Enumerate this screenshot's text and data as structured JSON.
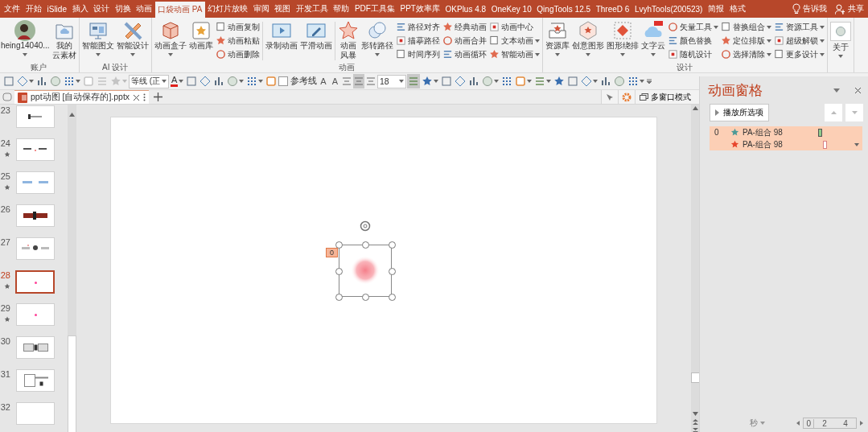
{
  "menu_tabs": [
    {
      "label": "文件",
      "selected": false
    },
    {
      "label": "开始",
      "selected": false
    },
    {
      "label": "iSlide",
      "selected": false
    },
    {
      "label": "插入",
      "selected": false
    },
    {
      "label": "设计",
      "selected": false
    },
    {
      "label": "切换",
      "selected": false
    },
    {
      "label": "动画",
      "selected": false
    },
    {
      "label": "口袋动画 PA",
      "selected": true
    },
    {
      "label": "幻灯片放映",
      "selected": false
    },
    {
      "label": "审阅",
      "selected": false
    },
    {
      "label": "视图",
      "selected": false
    },
    {
      "label": "开发工具",
      "selected": false
    },
    {
      "label": "帮助",
      "selected": false
    },
    {
      "label": "PDF工具集",
      "selected": false
    },
    {
      "label": "PPT效率库",
      "selected": false
    },
    {
      "label": "OKPlus 4.8",
      "selected": false
    },
    {
      "label": "OneKey 10",
      "selected": false
    },
    {
      "label": "QingTools 12.5",
      "selected": false
    },
    {
      "label": "ThreeD 6",
      "selected": false
    },
    {
      "label": "LvyhTools(200523)",
      "selected": false
    },
    {
      "label": "简报",
      "selected": false
    },
    {
      "label": "格式",
      "selected": false
    }
  ],
  "tell_me": "告诉我",
  "share": "共享",
  "ribbon_groups": [
    {
      "label": "账户",
      "columns": [
        {
          "kind": "account",
          "label": "heing14040...",
          "dropdown": true
        },
        {
          "kind": "large",
          "lines": [
            "我的",
            "云素材"
          ],
          "dropdown": false
        }
      ]
    },
    {
      "label": "AI 设计",
      "columns": [
        {
          "kind": "large",
          "label": "智能图文",
          "dropdown": true
        },
        {
          "kind": "large",
          "label": "智能设计",
          "dropdown": true
        }
      ]
    },
    {
      "label": "动画",
      "columns": [
        {
          "kind": "large",
          "label": "动画盒子",
          "dropdown": true
        },
        {
          "kind": "large",
          "label": "动画库",
          "dropdown": false
        },
        {
          "kind": "small",
          "items": [
            {
              "label": "动画复制",
              "dropdown": false
            },
            {
              "label": "动画粘贴",
              "dropdown": false
            },
            {
              "label": "动画删除",
              "dropdown": false
            }
          ]
        },
        {
          "kind": "separator"
        },
        {
          "kind": "large",
          "label": "录制动画",
          "dropdown": false
        },
        {
          "kind": "large",
          "label": "平滑动画",
          "dropdown": false
        },
        {
          "kind": "separator"
        },
        {
          "kind": "large",
          "lines": [
            "动画",
            "风暴"
          ],
          "dropdown": false
        },
        {
          "kind": "large",
          "label": "形转路径",
          "dropdown": true
        },
        {
          "kind": "small",
          "items": [
            {
              "label": "路径对齐",
              "dropdown": false
            },
            {
              "label": "描摹路径",
              "dropdown": false
            },
            {
              "label": "时间序列",
              "dropdown": false
            }
          ]
        },
        {
          "kind": "small",
          "items": [
            {
              "label": "经典动画",
              "dropdown": false
            },
            {
              "label": "动画合并",
              "dropdown": false
            },
            {
              "label": "动画循环",
              "dropdown": false
            }
          ]
        },
        {
          "kind": "small",
          "items": [
            {
              "label": "动画中心",
              "dropdown": false
            },
            {
              "label": "文本动画",
              "dropdown": true
            },
            {
              "label": "智能动画",
              "dropdown": true
            }
          ]
        }
      ]
    },
    {
      "label": "设计",
      "columns": [
        {
          "kind": "large",
          "label": "资源库",
          "dropdown": true
        },
        {
          "kind": "large",
          "label": "创意图形",
          "dropdown": true
        },
        {
          "kind": "large",
          "label": "图形绕排",
          "dropdown": true
        },
        {
          "kind": "large",
          "label": "文字云",
          "dropdown": true
        },
        {
          "kind": "small",
          "items": [
            {
              "label": "矢量工具",
              "dropdown": true
            },
            {
              "label": "颜色替换",
              "dropdown": false
            },
            {
              "label": "随机设计",
              "dropdown": false
            }
          ]
        },
        {
          "kind": "small",
          "items": [
            {
              "label": "替换组合",
              "dropdown": true
            },
            {
              "label": "定位排版",
              "dropdown": true
            },
            {
              "label": "选择清除",
              "dropdown": true
            }
          ]
        },
        {
          "kind": "small",
          "items": [
            {
              "label": "资源工具",
              "dropdown": true
            },
            {
              "label": "超级解锁",
              "dropdown": true
            },
            {
              "label": "更多设计",
              "dropdown": true
            }
          ]
        }
      ]
    },
    {
      "columns": [
        {
          "kind": "about",
          "label": "关于",
          "dropdown": true
        }
      ]
    }
  ],
  "toolbar": [
    {
      "kind": "icon",
      "dropdown": false,
      "disabled": false
    },
    {
      "kind": "icon",
      "dropdown": true,
      "disabled": false
    },
    {
      "kind": "icon",
      "dropdown": false,
      "disabled": false
    },
    {
      "kind": "icon",
      "dropdown": false,
      "disabled": false
    },
    {
      "kind": "icon",
      "dropdown": true,
      "disabled": false
    },
    {
      "kind": "icon",
      "dropdown": false,
      "disabled": true
    },
    {
      "kind": "icon",
      "dropdown": false,
      "disabled": true
    },
    {
      "kind": "icon",
      "dropdown": true,
      "disabled": true
    },
    {
      "kind": "font",
      "value": "等线 (正"
    },
    {
      "kind": "font-color",
      "label": "A",
      "dropdown": true
    },
    {
      "kind": "icon",
      "dropdown": false,
      "disabled": false
    },
    {
      "kind": "icon",
      "dropdown": false,
      "disabled": false
    },
    {
      "kind": "icon",
      "dropdown": false,
      "disabled": false
    },
    {
      "kind": "icon",
      "dropdown": true,
      "disabled": false
    },
    {
      "kind": "icon",
      "dropdown": true,
      "disabled": false
    },
    {
      "kind": "icon",
      "dropdown": false,
      "disabled": false
    },
    {
      "kind": "checkbox",
      "label": "参考线",
      "checked": false
    },
    {
      "kind": "letter",
      "label": "A"
    },
    {
      "kind": "letter",
      "label": "A"
    },
    {
      "kind": "align",
      "selected": false
    },
    {
      "kind": "align",
      "selected": true
    },
    {
      "kind": "align",
      "selected": false
    },
    {
      "kind": "size",
      "value": "18"
    },
    {
      "kind": "icon",
      "dropdown": false,
      "disabled": false,
      "selected": true
    },
    {
      "kind": "icon",
      "dropdown": true,
      "disabled": false
    },
    {
      "kind": "icon",
      "dropdown": false,
      "disabled": false
    },
    {
      "kind": "icon",
      "dropdown": false,
      "disabled": false
    },
    {
      "kind": "icon",
      "dropdown": false,
      "disabled": false
    },
    {
      "kind": "icon",
      "dropdown": true,
      "disabled": false
    },
    {
      "kind": "icon",
      "dropdown": false,
      "disabled": false
    },
    {
      "kind": "icon",
      "dropdown": true,
      "disabled": false
    },
    {
      "kind": "icon",
      "dropdown": true,
      "disabled": false
    },
    {
      "kind": "icon",
      "dropdown": false,
      "disabled": false
    },
    {
      "kind": "icon",
      "dropdown": false,
      "disabled": false
    },
    {
      "kind": "icon",
      "dropdown": true,
      "disabled": false
    },
    {
      "kind": "icon",
      "dropdown": false,
      "disabled": false
    },
    {
      "kind": "icon",
      "dropdown": false,
      "disabled": false
    },
    {
      "kind": "icon",
      "dropdown": true,
      "disabled": false
    },
    {
      "kind": "overflow"
    }
  ],
  "document_tab": {
    "title": "ppt动图  [自动保存的].pptx"
  },
  "multi_window": "多窗口模式",
  "slides": [
    {
      "number": "23",
      "starred": false,
      "selected": false,
      "kind": "line"
    },
    {
      "number": "24",
      "starred": true,
      "selected": false,
      "kind": "pair"
    },
    {
      "number": "25",
      "starred": true,
      "selected": false,
      "kind": "boxes"
    },
    {
      "number": "26",
      "starred": false,
      "selected": false,
      "kind": "title"
    },
    {
      "number": "27",
      "starred": false,
      "selected": false,
      "kind": "diagram"
    },
    {
      "number": "28",
      "starred": true,
      "selected": true,
      "kind": "dot"
    },
    {
      "number": "29",
      "starred": true,
      "selected": false,
      "kind": "dot"
    },
    {
      "number": "30",
      "starred": false,
      "selected": false,
      "kind": "frames"
    },
    {
      "number": "31",
      "starred": false,
      "selected": false,
      "kind": "panel"
    },
    {
      "number": "32",
      "starred": false,
      "selected": false,
      "kind": "blank"
    }
  ],
  "canvas": {
    "shape": {
      "tag": "0",
      "selected": true
    }
  },
  "animation_pane": {
    "title": "动画窗格",
    "play_button": "播放所选项",
    "items": [
      {
        "order": "0",
        "name": "PA-组合 98",
        "kind": "entrance",
        "color": "#4e9a97",
        "selected": true,
        "menu": false
      },
      {
        "name": "PA-组合 98",
        "kind": "exit",
        "color": "#e8452c",
        "selected": true,
        "menu": true
      }
    ],
    "time_unit": "秒",
    "ticks": [
      "0",
      "2",
      "4"
    ]
  }
}
